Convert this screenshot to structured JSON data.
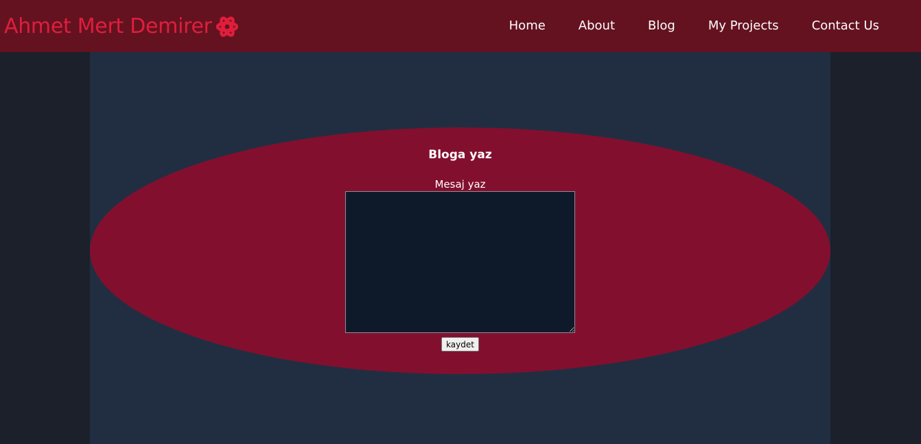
{
  "navbar": {
    "brand": "Ahmet Mert Demirer",
    "brand_icon": "atom-icon",
    "brand_color": "#e01e3c",
    "background": "#641220",
    "links": [
      {
        "label": "Home"
      },
      {
        "label": "About"
      },
      {
        "label": "Blog"
      },
      {
        "label": "My Projects"
      },
      {
        "label": "Contact Us"
      }
    ]
  },
  "blog_form": {
    "title": "Bloga yaz",
    "message_label": "Mesaj yaz",
    "message_value": "",
    "submit_label": "kaydet",
    "ellipse_color": "#830f2e"
  },
  "colors": {
    "page_background": "#1b202b",
    "content_background": "#212e42",
    "textarea_background": "#0e1a2a"
  }
}
